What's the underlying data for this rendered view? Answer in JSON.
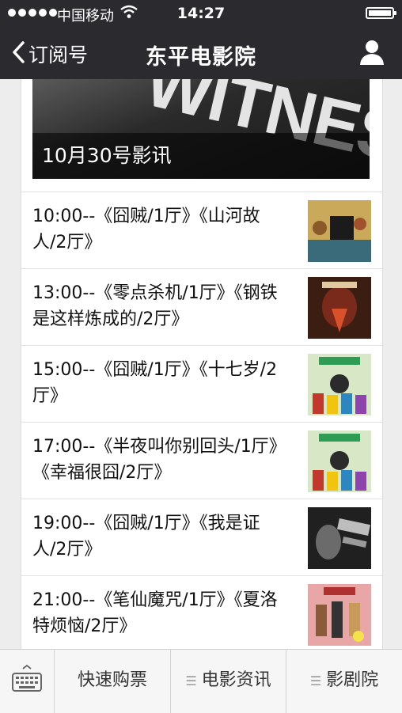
{
  "status": {
    "carrier": "中国移动",
    "time": "14:27",
    "signal_bars": 5,
    "battery_level": 0.95
  },
  "nav": {
    "back_label": "订阅号",
    "title": "东平电影院",
    "back_icon": "chevron-left-icon",
    "profile_icon": "person-icon"
  },
  "banner": {
    "caption": "10月30号影讯",
    "art_text": "WITNESS"
  },
  "schedule": [
    {
      "text": "10:00--《囧贼/1厅》《山河故人/2厅》",
      "poster_colors": [
        "#caa95a",
        "#3a6b7a"
      ]
    },
    {
      "text": "13:00--《零点杀机/1厅》《钢铁是这样炼成的/2厅》",
      "poster_colors": [
        "#7a2a1a",
        "#d9512a"
      ]
    },
    {
      "text": "15:00--《囧贼/1厅》《十七岁/2厅》",
      "poster_colors": [
        "#d8e8c6",
        "#2e9c55"
      ]
    },
    {
      "text": "17:00--《半夜叫你别回头/1厅》《幸福很囧/2厅》",
      "poster_colors": [
        "#d8e8c6",
        "#2e9c55"
      ]
    },
    {
      "text": "19:00--《囧贼/1厅》《我是证人/2厅》",
      "poster_colors": [
        "#202020",
        "#bdbdbd"
      ]
    },
    {
      "text": "21:00--《笔仙魔咒/1厅》《夏洛特烦恼/2厅》",
      "poster_colors": [
        "#e9a6a6",
        "#8a5a3a"
      ]
    }
  ],
  "toolbar": {
    "keyboard_icon": "keyboard-icon",
    "items": [
      "快速购票",
      "电影资讯",
      "影剧院"
    ]
  },
  "colors": {
    "bar_bg": "#2b2b2f",
    "page_bg": "#ededed"
  }
}
